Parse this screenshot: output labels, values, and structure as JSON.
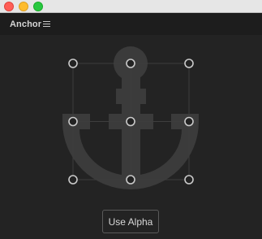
{
  "window": {
    "controls": [
      "close",
      "minimize",
      "maximize"
    ]
  },
  "panel": {
    "title": "Anchor",
    "menu_icon": "hamburger-menu-icon"
  },
  "canvas": {
    "graphic": "anchor-icon",
    "selected_anchor_point": "center"
  },
  "actions": {
    "use_alpha_label": "Use Alpha"
  },
  "colors": {
    "background": "#232323",
    "header": "#1d1d1d",
    "graphic": "#3b3b3b",
    "handle_stroke": "#c9c9c9"
  }
}
